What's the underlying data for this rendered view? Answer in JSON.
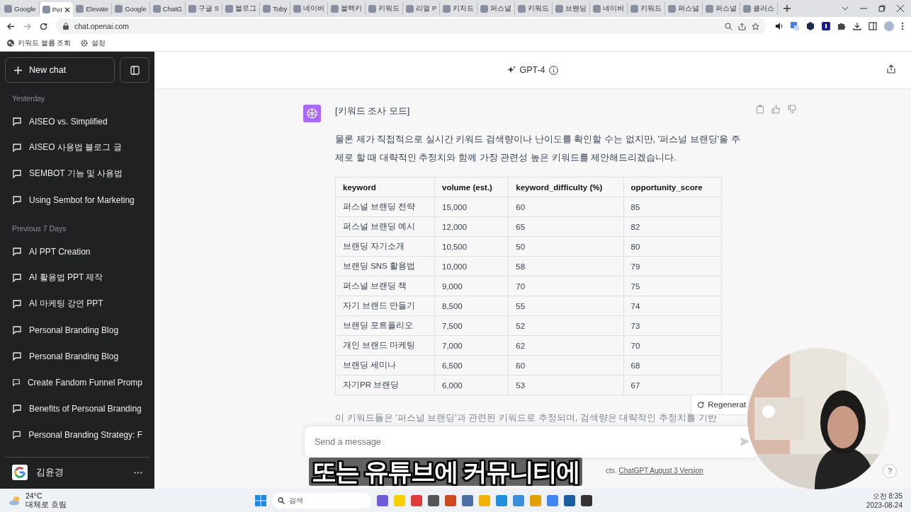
{
  "browser": {
    "tabs": [
      {
        "label": "Google",
        "selected": false
      },
      {
        "label": "Per",
        "selected": true
      },
      {
        "label": "Elevate",
        "selected": false
      },
      {
        "label": "Google",
        "selected": false
      },
      {
        "label": "ChatG",
        "selected": false
      },
      {
        "label": "구글 S",
        "selected": false
      },
      {
        "label": "블로그",
        "selected": false
      },
      {
        "label": "Toby",
        "selected": false
      },
      {
        "label": "네이버",
        "selected": false
      },
      {
        "label": "블랙키",
        "selected": false
      },
      {
        "label": "키워드",
        "selected": false
      },
      {
        "label": "리얼 P",
        "selected": false
      },
      {
        "label": "키자드",
        "selected": false
      },
      {
        "label": "퍼스널",
        "selected": false
      },
      {
        "label": "키워드",
        "selected": false
      },
      {
        "label": "브랜딩",
        "selected": false
      },
      {
        "label": "네이버",
        "selected": false
      },
      {
        "label": "키워드",
        "selected": false
      },
      {
        "label": "퍼스널",
        "selected": false
      },
      {
        "label": "퍼스널",
        "selected": false
      },
      {
        "label": "클러스",
        "selected": false
      }
    ],
    "url": "chat.openai.com",
    "bookmarks": [
      "키워드 볼륨 조회",
      "설정"
    ]
  },
  "sidebar": {
    "new_chat": "New chat",
    "sections": [
      {
        "heading": "Yesterday",
        "items": [
          "AISEO vs. Simplified",
          "AISEO 사용법 블로그 글",
          "SEMBOT 기능 및 사용법",
          "Using Sembot for Marketing"
        ]
      },
      {
        "heading": "Previous 7 Days",
        "items": [
          "AI PPT Creation",
          "AI 활용법 PPT 제작",
          "AI 마케팅 강연 PPT",
          "Personal Branding Blog",
          "Personal Branding Blog",
          "Create Fandom Funnel Promp",
          "Benefits of Personal Branding",
          "Personal Branding Strategy: F"
        ]
      }
    ],
    "user": "김윤경"
  },
  "header": {
    "model": "GPT-4"
  },
  "message": {
    "title": "[키워드 조사 모드]",
    "intro": "물론 제가 직접적으로 실시간 키워드 검색량이나 난이도를 확인할 수는 없지만, '퍼스널 브랜딩'을 주제로 할 때 대략적인 추정치와 함께 가장 관련성 높은 키워드를 제안해드리겠습니다.",
    "table": {
      "columns": [
        "keyword",
        "volume (est.)",
        "keyword_difficulty (%)",
        "opportunity_score"
      ],
      "rows": [
        [
          "퍼스널 브랜딩 전략",
          "15,000",
          "60",
          "85"
        ],
        [
          "퍼스널 브랜딩 예시",
          "12,000",
          "65",
          "82"
        ],
        [
          "브랜딩 자기소개",
          "10,500",
          "50",
          "80"
        ],
        [
          "브랜딩 SNS 활용법",
          "10,000",
          "58",
          "79"
        ],
        [
          "퍼스널 브랜딩 책",
          "9,000",
          "70",
          "75"
        ],
        [
          "자기 브랜드 만들기",
          "8,500",
          "55",
          "74"
        ],
        [
          "브랜딩 포트폴리오",
          "7,500",
          "52",
          "73"
        ],
        [
          "개인 브랜드 마케팅",
          "7,000",
          "62",
          "70"
        ],
        [
          "브랜딩 세미나",
          "6,500",
          "60",
          "68"
        ],
        [
          "자기PR 브랜딩",
          "6,000",
          "53",
          "67"
        ]
      ]
    },
    "outro": "이 키워드들은 '퍼스널 브랜딩'과 관련된 키워드로 추정되며, 검색량은 대략적인 추정치를 기반"
  },
  "regenerate": "Regenerat",
  "help": "?",
  "composer": {
    "placeholder": "Send a message"
  },
  "footer": {
    "text": "cts.",
    "link": "ChatGPT August 3 Version"
  },
  "caption": "또는 유튜브에 커뮤니티에",
  "taskbar": {
    "temperature": "24°C",
    "weather": "대체로 흐림",
    "search_placeholder": "검색",
    "time": "오전 8:35",
    "date": "2023-08-24"
  }
}
